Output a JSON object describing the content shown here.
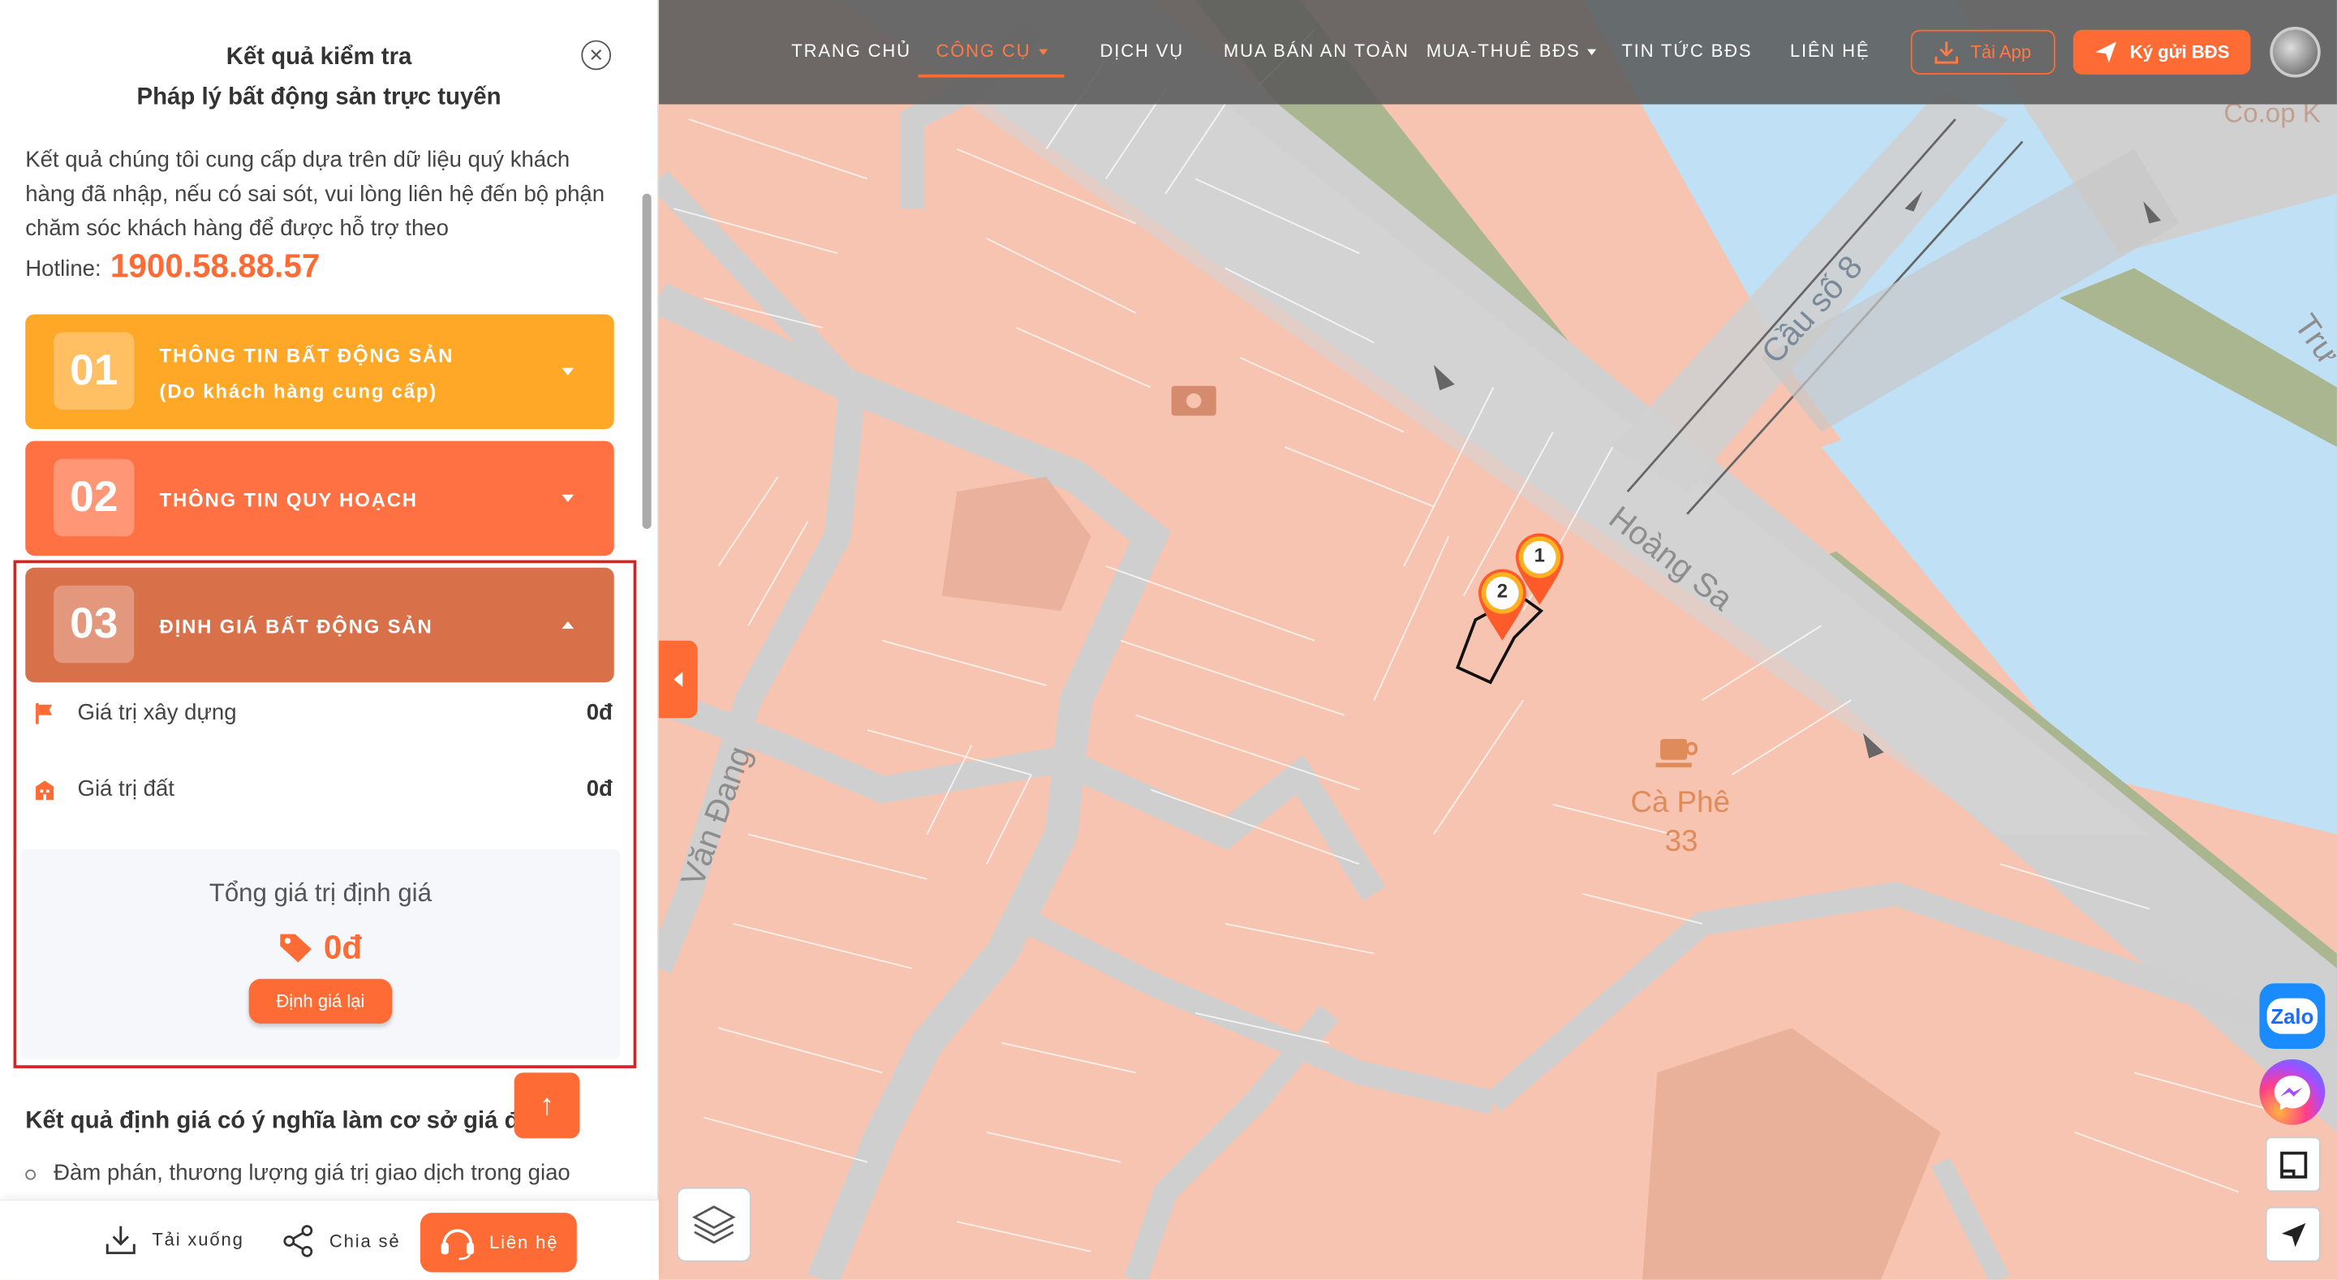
{
  "nav": {
    "items": [
      "TRANG CHỦ",
      "CÔNG CỤ",
      "DỊCH VỤ",
      "MUA BÁN AN TOÀN",
      "MUA-THUÊ BĐS",
      "TIN TỨC BĐS",
      "LIÊN HỆ"
    ],
    "active_index": 1,
    "download_app": "Tải App",
    "consign": "Ký gửi BĐS"
  },
  "panel": {
    "title_line1": "Kết quả kiểm tra",
    "title_line2": "Pháp lý bất động sản trực tuyến",
    "intro": "Kết quả chúng tôi cung cấp dựa trên dữ liệu quý khách hàng đã nhập, nếu có sai sót, vui lòng liên hệ đến bộ phận chăm sóc khách hàng để được hỗ trợ theo",
    "hotline_label": "Hotline:",
    "hotline_number": "1900.58.88.57",
    "sections": [
      {
        "num": "01",
        "title": "THÔNG TIN BẤT ĐỘNG SẢN",
        "subtitle": "(Do khách hàng cung cấp)",
        "color": "#ffa726",
        "expanded": false
      },
      {
        "num": "02",
        "title": "THÔNG TIN QUY HOẠCH",
        "color": "#ff7043",
        "expanded": false
      },
      {
        "num": "03",
        "title": "ĐỊNH GIÁ BẤT ĐỘNG SẢN",
        "color": "#d8704a",
        "expanded": true
      }
    ],
    "valuation": {
      "construction_label": "Giá trị xây dựng",
      "construction_value": "0đ",
      "land_label": "Giá trị đất",
      "land_value": "0đ",
      "total_label": "Tổng giá trị định giá",
      "total_value": "0đ",
      "revalue_button": "Định giá lại"
    },
    "note_title": "Kết quả định giá có ý nghĩa làm cơ sở giá để:",
    "note_item": "Đàm phán, thương lượng giá trị giao dịch trong giao",
    "bottom": {
      "download": "Tải xuống",
      "share": "Chia sẻ",
      "contact": "Liên hệ"
    }
  },
  "map": {
    "labels": {
      "bridge": "Cầu số 8",
      "street1": "Hoàng Sa",
      "street2": "Văn Đang",
      "cafe_line1": "Cà Phê",
      "cafe_line2": "33",
      "corner": "Co.op K",
      "tru": "Trư"
    },
    "pins": [
      "1",
      "2"
    ]
  },
  "float": {
    "zalo": "Zalo"
  },
  "colors": {
    "accent": "#ff6b35",
    "map_land": "#f6c4b0",
    "water": "#bfe0f5",
    "park": "#a9b68f",
    "road": "#c9c9c9",
    "highlight_box": "#e02020"
  }
}
